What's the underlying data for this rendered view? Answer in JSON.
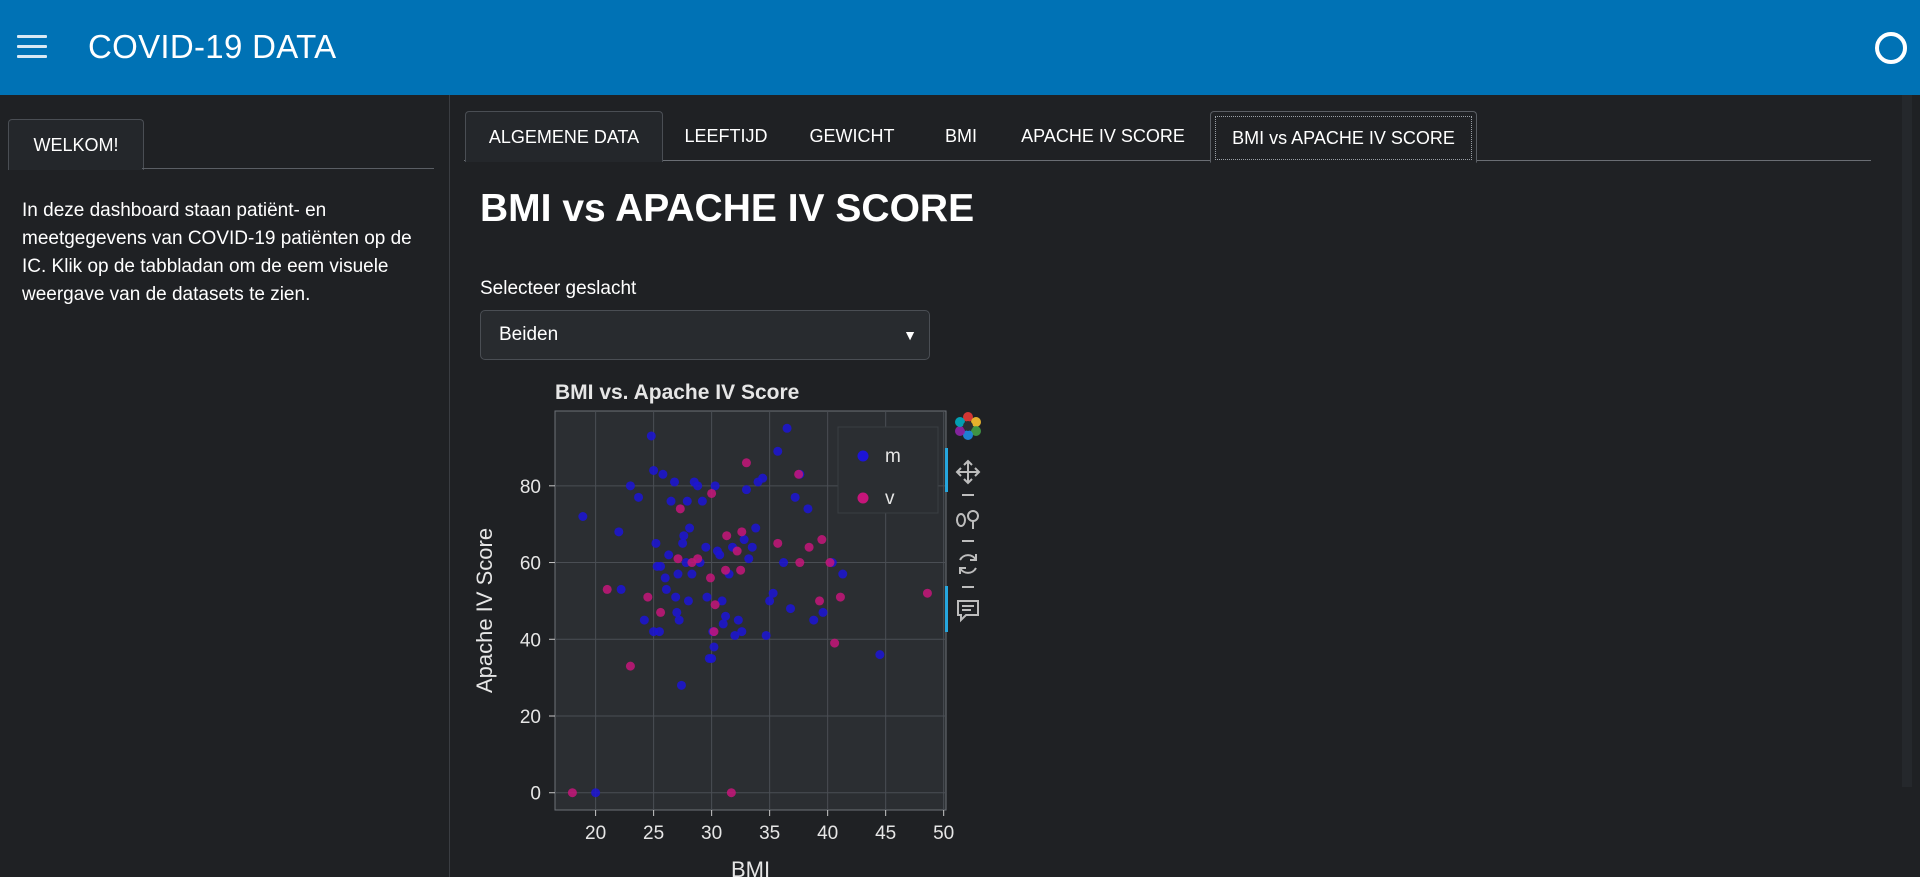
{
  "header": {
    "title": "COVID-19 DATA"
  },
  "sidebar": {
    "tab_label": "WELKOM!",
    "intro": "In deze dashboard staan patiënt- en meetgegevens van COVID-19 patiënten op de IC. Klik op de tabbladan om de eem visuele weergave van de datasets te zien."
  },
  "tabs": [
    {
      "label": "ALGEMENE DATA"
    },
    {
      "label": "LEEFTIJD"
    },
    {
      "label": "GEWICHT"
    },
    {
      "label": "BMI"
    },
    {
      "label": "APACHE IV SCORE"
    },
    {
      "label": "BMI vs APACHE IV SCORE"
    }
  ],
  "active_tab": "BMI vs APACHE IV SCORE",
  "main": {
    "title": "BMI vs APACHE IV SCORE",
    "gender_select": {
      "label": "Selecteer geslacht",
      "value": "Beiden"
    }
  },
  "toolbar": {
    "icons": [
      "bokeh-logo-icon",
      "pan-icon",
      "wheel-zoom-icon",
      "reset-icon",
      "hover-icon"
    ]
  },
  "colors": {
    "header": "#0072b5",
    "male": "#1c14d6",
    "female": "#c6157a",
    "background": "#1f2124"
  },
  "chart_data": {
    "type": "scatter",
    "title": "BMI vs. Apache IV Score",
    "xlabel": "BMI",
    "ylabel": "Apache IV Score",
    "xlim": [
      16.5,
      50.2
    ],
    "ylim": [
      -4.5,
      99.5
    ],
    "xticks": [
      20,
      25,
      30,
      35,
      40,
      45,
      50
    ],
    "yticks": [
      0,
      20,
      40,
      60,
      80
    ],
    "grid": true,
    "legend_position": "top-right",
    "series": [
      {
        "name": "m",
        "color": "#1c14d6",
        "points": [
          [
            18.9,
            72
          ],
          [
            20.0,
            0
          ],
          [
            22.0,
            68
          ],
          [
            23.0,
            80
          ],
          [
            23.7,
            77
          ],
          [
            24.2,
            45
          ],
          [
            24.8,
            93
          ],
          [
            25.0,
            84
          ],
          [
            25.2,
            65
          ],
          [
            25.5,
            42
          ],
          [
            25.0,
            42
          ],
          [
            25.6,
            59
          ],
          [
            25.8,
            83
          ],
          [
            26.0,
            56
          ],
          [
            26.1,
            53
          ],
          [
            26.3,
            62
          ],
          [
            26.5,
            76
          ],
          [
            26.8,
            81
          ],
          [
            26.9,
            51
          ],
          [
            27.1,
            57
          ],
          [
            27.2,
            45
          ],
          [
            27.4,
            28
          ],
          [
            27.5,
            65
          ],
          [
            27.6,
            67
          ],
          [
            27.8,
            60
          ],
          [
            27.9,
            76
          ],
          [
            28.0,
            50
          ],
          [
            28.1,
            69
          ],
          [
            28.3,
            57
          ],
          [
            28.5,
            81
          ],
          [
            28.8,
            80
          ],
          [
            29.0,
            60
          ],
          [
            29.2,
            76
          ],
          [
            29.5,
            64
          ],
          [
            29.6,
            51
          ],
          [
            29.8,
            35
          ],
          [
            30.0,
            35
          ],
          [
            30.1,
            42
          ],
          [
            30.2,
            38
          ],
          [
            30.3,
            80
          ],
          [
            30.5,
            63
          ],
          [
            30.7,
            62
          ],
          [
            30.9,
            50
          ],
          [
            31.2,
            46
          ],
          [
            31.5,
            57
          ],
          [
            31.8,
            64
          ],
          [
            32.0,
            41
          ],
          [
            32.3,
            45
          ],
          [
            32.6,
            42
          ],
          [
            32.8,
            66
          ],
          [
            33.0,
            79
          ],
          [
            33.2,
            61
          ],
          [
            33.5,
            64
          ],
          [
            33.8,
            69
          ],
          [
            34.0,
            81
          ],
          [
            34.4,
            82
          ],
          [
            34.7,
            41
          ],
          [
            35.0,
            50
          ],
          [
            35.3,
            52
          ],
          [
            35.7,
            89
          ],
          [
            36.2,
            60
          ],
          [
            36.5,
            95
          ],
          [
            36.8,
            48
          ],
          [
            37.2,
            77
          ],
          [
            37.6,
            83
          ],
          [
            38.3,
            74
          ],
          [
            38.8,
            45
          ],
          [
            39.6,
            47
          ],
          [
            40.4,
            60
          ],
          [
            41.3,
            57
          ],
          [
            41.5,
            74
          ],
          [
            44.5,
            36
          ],
          [
            22.2,
            53
          ],
          [
            27.0,
            47
          ],
          [
            31.0,
            44
          ],
          [
            25.3,
            59
          ]
        ]
      },
      {
        "name": "v",
        "color": "#c6157a",
        "points": [
          [
            18.0,
            0
          ],
          [
            21.0,
            53
          ],
          [
            23.0,
            33
          ],
          [
            24.5,
            51
          ],
          [
            25.6,
            47
          ],
          [
            27.1,
            61
          ],
          [
            27.3,
            74
          ],
          [
            28.3,
            60
          ],
          [
            28.8,
            61
          ],
          [
            29.9,
            56
          ],
          [
            30.0,
            78
          ],
          [
            30.2,
            42
          ],
          [
            30.3,
            49
          ],
          [
            31.2,
            58
          ],
          [
            31.3,
            67
          ],
          [
            31.7,
            0
          ],
          [
            32.2,
            63
          ],
          [
            32.5,
            58
          ],
          [
            32.6,
            68
          ],
          [
            33.0,
            86
          ],
          [
            35.7,
            65
          ],
          [
            37.5,
            83
          ],
          [
            37.6,
            60
          ],
          [
            38.4,
            64
          ],
          [
            39.3,
            50
          ],
          [
            39.5,
            66
          ],
          [
            40.2,
            60
          ],
          [
            40.6,
            39
          ],
          [
            41.1,
            51
          ],
          [
            48.6,
            52
          ]
        ]
      }
    ]
  }
}
